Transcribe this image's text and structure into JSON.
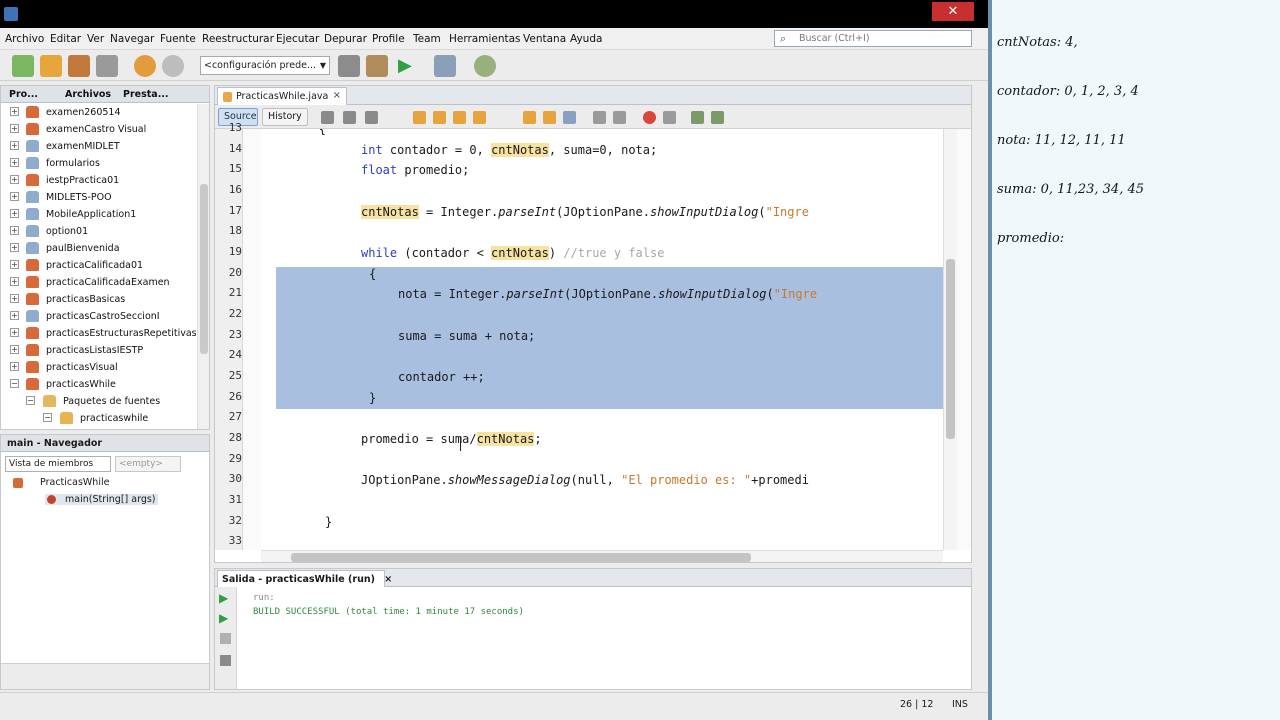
{
  "window": {
    "close_symbol": "✕"
  },
  "menu": [
    "Archivo",
    "Editar",
    "Ver",
    "Navegar",
    "Fuente",
    "Reestructurar",
    "Ejecutar",
    "Depurar",
    "Profile",
    "Team",
    "Herramientas",
    "Ventana",
    "Ayuda"
  ],
  "search": {
    "placeholder": "Buscar (Ctrl+I)",
    "icon": "search-icon"
  },
  "toolbar": {
    "config_value": "<configuración prede...",
    "icons": [
      "new-file-icon",
      "new-project-icon",
      "open-project-icon",
      "close-project-icon",
      "undo-icon",
      "redo-icon",
      "build-icon",
      "clean-build-icon",
      "run-icon",
      "debug-icon",
      "profile-icon"
    ]
  },
  "projects_panel": {
    "tabs": [
      "Pro...",
      "Archivos",
      "Presta..."
    ],
    "items": [
      "examen260514",
      "examenCastro Visual",
      "examenMIDLET",
      "formularios",
      "iestpPractica01",
      "MIDLETS-POO",
      "MobileApplication1",
      "option01",
      "paulBienvenida",
      "practicaCalificada01",
      "practicaCalificadaExamen",
      "practicasBasicas",
      "practicasCastroSeccionI",
      "practicasEstructurasRepetitivas",
      "practicasListasIESTP",
      "practicasVisual",
      "practicasWhile",
      "Paquetes de fuentes",
      "practicaswhile"
    ]
  },
  "navigator": {
    "title": "main - Navegador",
    "filter": "Vista de miembros",
    "filter2": "<empty>",
    "class_name": "PracticasWhile",
    "method": "main(String[] args)"
  },
  "editor": {
    "tab_label": "PracticasWhile.java",
    "source_label": "Source",
    "history_label": "History",
    "line_numbers": [
      "13",
      "14",
      "15",
      "16",
      "17",
      "18",
      "19",
      "20",
      "21",
      "22",
      "23",
      "24",
      "25",
      "26",
      "27",
      "28",
      "29",
      "30",
      "31",
      "32",
      "33"
    ],
    "code": {
      "l13": "        {",
      "l14_kw": "int",
      "l14_a": " contador = 0, ",
      "l14_hl": "cntNotas",
      "l14_b": ", suma=0, nota;",
      "l15_kw": "float",
      "l15_a": " promedio;",
      "l17_hl": "cntNotas",
      "l17_a": " = Integer.",
      "l17_it1": "parseInt",
      "l17_b": "(JOptionPane.",
      "l17_it2": "showInputDialog",
      "l17_c": "(",
      "l17_str": "\"Ingre",
      "l19_kw": "while",
      "l19_a": " (contador < ",
      "l19_hl": "cntNotas",
      "l19_b": ") ",
      "l19_cm": "//true y false",
      "l20": "{",
      "l21_a": "nota = Integer.",
      "l21_it1": "parseInt",
      "l21_b": "(JOptionPane.",
      "l21_it2": "showInputDialog",
      "l21_c": "(",
      "l21_str": "\"Ingre",
      "l23": "suma = suma + nota;",
      "l25": "contador ++;",
      "l26": "}",
      "l28_a": "promedio = suma/",
      "l28_hl": "cntNotas",
      "l28_b": ";",
      "l30_a": "JOptionPane.",
      "l30_it": "showMessageDialog",
      "l30_b": "(null, ",
      "l30_str": "\"El promedio es: \"",
      "l30_c": "+promedi",
      "l32": "}"
    }
  },
  "output": {
    "tab_label": "Salida - practicasWhile (run)",
    "lines": [
      "run:",
      "BUILD SUCCESSFUL (total time: 1 minute 17 seconds)"
    ],
    "line_colors": [
      "#8a8a8a",
      "#2e8b3a"
    ]
  },
  "status": {
    "position": "26 | 12",
    "mode": "INS"
  },
  "notes": [
    "cntNotas: 4,",
    "contador: 0, 1, 2, 3, 4",
    "nota: 11, 12, 11, 11",
    "suma: 0, 11,23, 34, 45",
    "promedio:"
  ]
}
